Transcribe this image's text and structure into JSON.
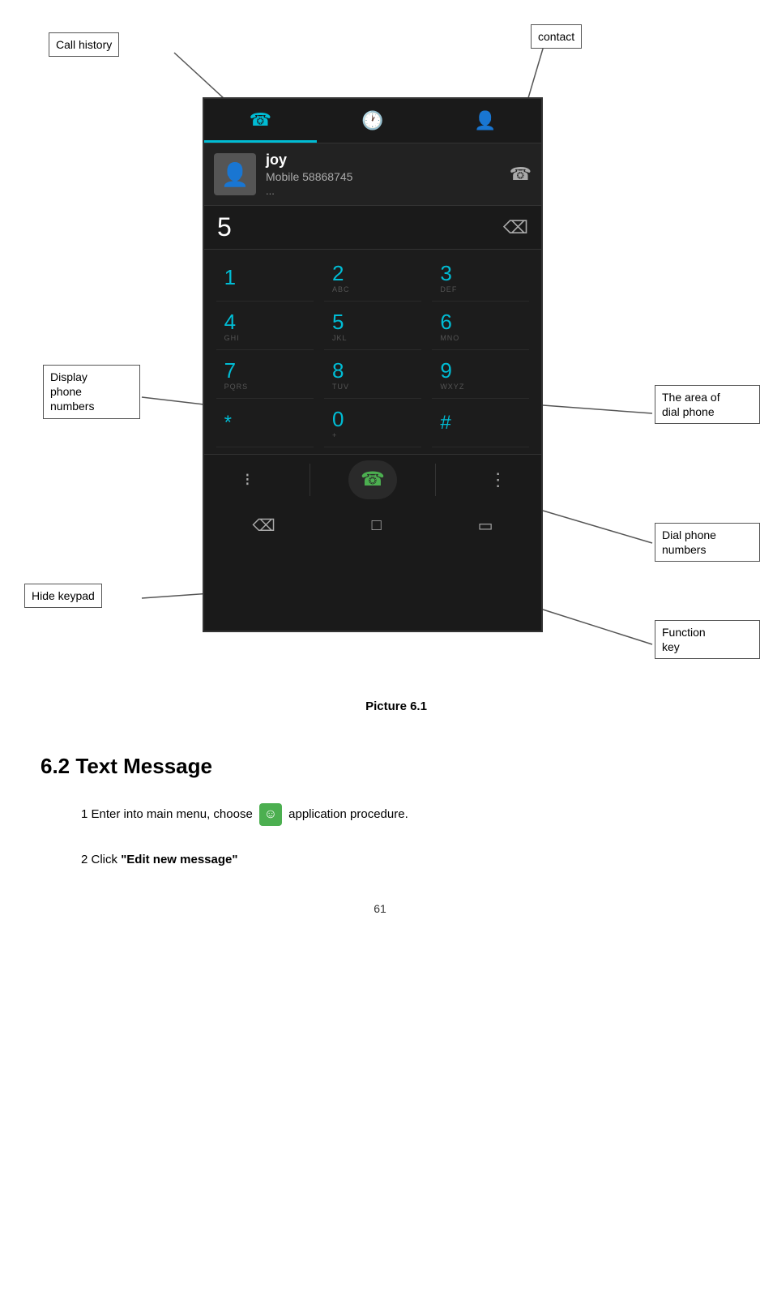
{
  "annotations": {
    "call_history": "Call history",
    "contact": "contact",
    "display_phone_numbers": "Display\nphone\nnumbers",
    "hide_keypad": "Hide keypad",
    "the_area_of_dial_phone": "The area of\ndial phone",
    "dial_phone_numbers": "Dial phone\nnumbers",
    "function_key": "Function\nkey"
  },
  "phone": {
    "contact_name": "joy",
    "contact_number": "Mobile 58868745",
    "contact_more": "...",
    "dial_display": "5",
    "keypad": [
      {
        "main": "1",
        "sub": ""
      },
      {
        "main": "2",
        "sub": "ABC"
      },
      {
        "main": "3",
        "sub": "DEF"
      },
      {
        "main": "4",
        "sub": "GHI"
      },
      {
        "main": "5",
        "sub": "JKL"
      },
      {
        "main": "6",
        "sub": "MNO"
      },
      {
        "main": "7",
        "sub": "PQRS"
      },
      {
        "main": "8",
        "sub": "TUV"
      },
      {
        "main": "9",
        "sub": "WXYZ"
      },
      {
        "main": "*",
        "sub": ""
      },
      {
        "main": "0",
        "sub": "+"
      },
      {
        "main": "#",
        "sub": ""
      }
    ]
  },
  "picture_caption": "Picture 6.1",
  "section": {
    "number": "6.2",
    "title": "Text Message"
  },
  "step1": {
    "prefix": "1 Enter into main menu, choose",
    "suffix": "application procedure."
  },
  "step2": {
    "text": "2 Click ",
    "bold": "\"Edit new message\""
  },
  "page_number": "61"
}
